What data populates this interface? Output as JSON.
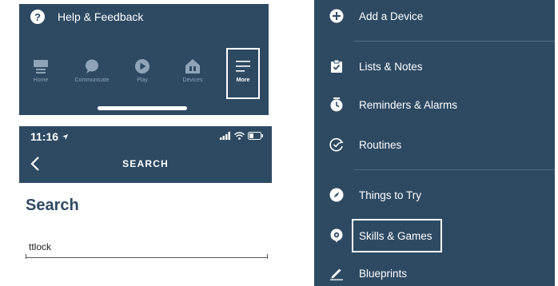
{
  "more_screen": {
    "help_label": "Help & Feedback",
    "help_icon": "question-circle-icon",
    "nav_items": [
      {
        "label": "Home",
        "icon": "home-icon"
      },
      {
        "label": "Communicate",
        "icon": "chat-bubble-icon"
      },
      {
        "label": "Play",
        "icon": "play-icon"
      },
      {
        "label": "Devices",
        "icon": "devices-house-icon"
      },
      {
        "label": "More",
        "icon": "hamburger-menu-icon",
        "selected": true
      }
    ]
  },
  "search_screen": {
    "time": "11:16",
    "title": "SEARCH",
    "heading": "Search",
    "search_value": "ttlock"
  },
  "menu": {
    "items": [
      {
        "label": "Add a Device",
        "icon": "plus-circle-icon"
      },
      {
        "label": "Lists & Notes",
        "icon": "clipboard-check-icon"
      },
      {
        "label": "Reminders & Alarms",
        "icon": "alarm-clock-icon"
      },
      {
        "label": "Routines",
        "icon": "routine-check-icon"
      },
      {
        "label": "Things to Try",
        "icon": "compass-icon"
      },
      {
        "label": "Skills & Games",
        "icon": "skills-bubble-icon",
        "highlighted": true
      },
      {
        "label": "Blueprints",
        "icon": "pencil-icon"
      }
    ]
  },
  "colors": {
    "navy": "#2e4a63",
    "text_light": "#ffffff",
    "nav_inactive": "#8fa4b8",
    "highlight": "#ffffff"
  }
}
